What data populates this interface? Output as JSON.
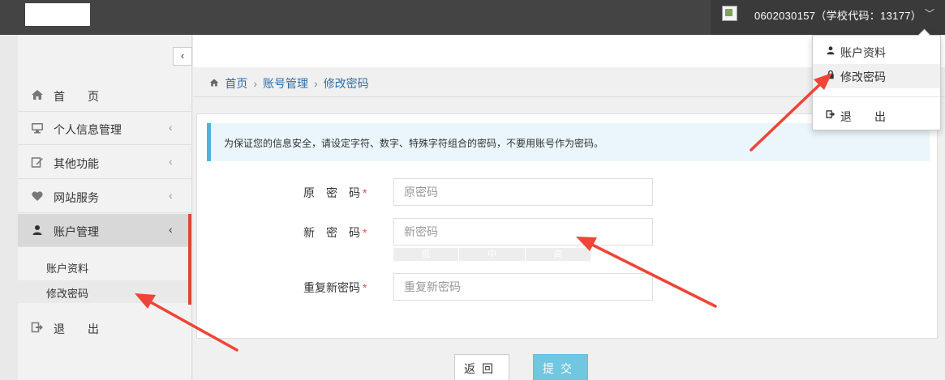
{
  "header": {
    "user_text": "0602030157（学校代码：13177）",
    "chevron": "﹀"
  },
  "sidebar": {
    "collapse_glyph": "‹",
    "items": [
      {
        "label": "首　　页",
        "icon": "home-icon"
      },
      {
        "label": "个人信息管理",
        "icon": "monitor-icon"
      },
      {
        "label": "其他功能",
        "icon": "edit-icon"
      },
      {
        "label": "网站服务",
        "icon": "heart-icon"
      },
      {
        "label": "账户管理",
        "icon": "user-icon"
      },
      {
        "label": "退　　出",
        "icon": "logout-icon"
      }
    ],
    "sub_items": [
      {
        "label": "账户资料"
      },
      {
        "label": "修改密码"
      }
    ],
    "chevron": "‹"
  },
  "breadcrumb": {
    "home": "首页",
    "level2": "账号管理",
    "level3": "修改密码",
    "sep": "›"
  },
  "notice": "为保证您的信息安全，请设定字符、数字、特殊字符组合的密码，不要用账号作为密码。",
  "form": {
    "old_password": {
      "label": "原　密　码",
      "placeholder": "原密码"
    },
    "new_password": {
      "label": "新　密　码",
      "placeholder": "新密码"
    },
    "repeat_password": {
      "label": "重复新密码",
      "placeholder": "重复新密码"
    },
    "required_mark": "*",
    "strength": [
      "低",
      "中",
      "高"
    ]
  },
  "buttons": {
    "back": "返回",
    "submit": "提交"
  },
  "dropdown": {
    "items": [
      {
        "label": "账户资料",
        "icon": "user-icon"
      },
      {
        "label": "修改密码",
        "icon": "lock-icon"
      },
      {
        "label": "退　　出",
        "icon": "logout-icon"
      }
    ]
  },
  "colors": {
    "topbar": "#444444",
    "accent_red": "#d84a38",
    "link_blue": "#2e6da4",
    "submit_blue": "#5bc0de",
    "notice_bg": "#eaf6fb",
    "arrow_red": "#ef4437"
  }
}
